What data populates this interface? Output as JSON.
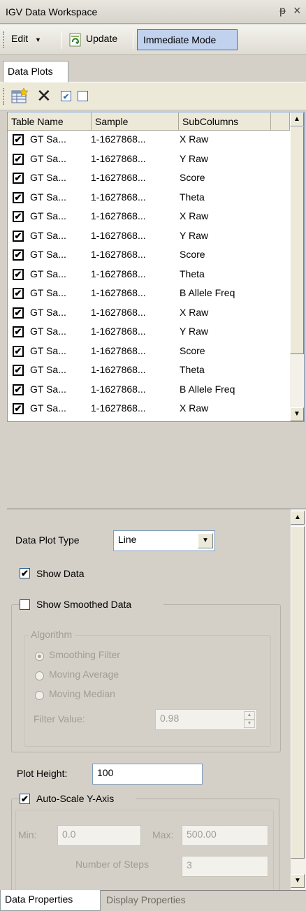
{
  "window": {
    "title": "IGV Data Workspace",
    "pin_glyph": "ᵽ",
    "close_glyph": "×"
  },
  "toolbar": {
    "edit_label": "Edit",
    "update_label": "Update",
    "immediate_mode_label": "Immediate Mode"
  },
  "tabs": {
    "data_plots": "Data Plots"
  },
  "grid": {
    "columns": [
      "Table Name",
      "Sample",
      "SubColumns"
    ],
    "rows": [
      {
        "checked": true,
        "table": "GT Sa...",
        "sample": "1-1627868...",
        "sub": "X Raw"
      },
      {
        "checked": true,
        "table": "GT Sa...",
        "sample": "1-1627868...",
        "sub": "Y Raw"
      },
      {
        "checked": true,
        "table": "GT Sa...",
        "sample": "1-1627868...",
        "sub": "Score"
      },
      {
        "checked": true,
        "table": "GT Sa...",
        "sample": "1-1627868...",
        "sub": "Theta"
      },
      {
        "checked": true,
        "table": "GT Sa...",
        "sample": "1-1627868...",
        "sub": "X Raw"
      },
      {
        "checked": true,
        "table": "GT Sa...",
        "sample": "1-1627868...",
        "sub": "Y Raw"
      },
      {
        "checked": true,
        "table": "GT Sa...",
        "sample": "1-1627868...",
        "sub": "Score"
      },
      {
        "checked": true,
        "table": "GT Sa...",
        "sample": "1-1627868...",
        "sub": "Theta"
      },
      {
        "checked": true,
        "table": "GT Sa...",
        "sample": "1-1627868...",
        "sub": "B Allele Freq"
      },
      {
        "checked": true,
        "table": "GT Sa...",
        "sample": "1-1627868...",
        "sub": "X Raw"
      },
      {
        "checked": true,
        "table": "GT Sa...",
        "sample": "1-1627868...",
        "sub": "Y Raw"
      },
      {
        "checked": true,
        "table": "GT Sa...",
        "sample": "1-1627868...",
        "sub": "Score"
      },
      {
        "checked": true,
        "table": "GT Sa...",
        "sample": "1-1627868...",
        "sub": "Theta"
      },
      {
        "checked": true,
        "table": "GT Sa...",
        "sample": "1-1627868...",
        "sub": "B Allele Freq"
      },
      {
        "checked": true,
        "table": "GT Sa...",
        "sample": "1-1627868...",
        "sub": "X Raw"
      }
    ]
  },
  "properties": {
    "plot_type_label": "Data Plot Type",
    "plot_type_value": "Line",
    "show_data_label": "Show Data",
    "show_data_checked": true,
    "show_smoothed_label": "Show Smoothed Data",
    "show_smoothed_checked": false,
    "algorithm_label": "Algorithm",
    "algorithms": [
      "Smoothing Filter",
      "Moving Average",
      "Moving Median"
    ],
    "algorithm_selected": "Smoothing Filter",
    "filter_value_label": "Filter Value:",
    "filter_value": "0.98",
    "plot_height_label": "Plot Height:",
    "plot_height_value": "100",
    "autoscale_label": "Auto-Scale Y-Axis",
    "autoscale_checked": true,
    "min_label": "Min:",
    "min_value": "0.0",
    "max_label": "Max:",
    "max_value": "500.00",
    "steps_label": "Number of Steps",
    "steps_value": "3"
  },
  "bottom_tabs": {
    "data_properties": "Data Properties",
    "display_properties": "Display Properties"
  },
  "icons": {
    "check": "✔",
    "x": "✕",
    "up": "▲",
    "down": "▼",
    "dropdown": "▼"
  }
}
